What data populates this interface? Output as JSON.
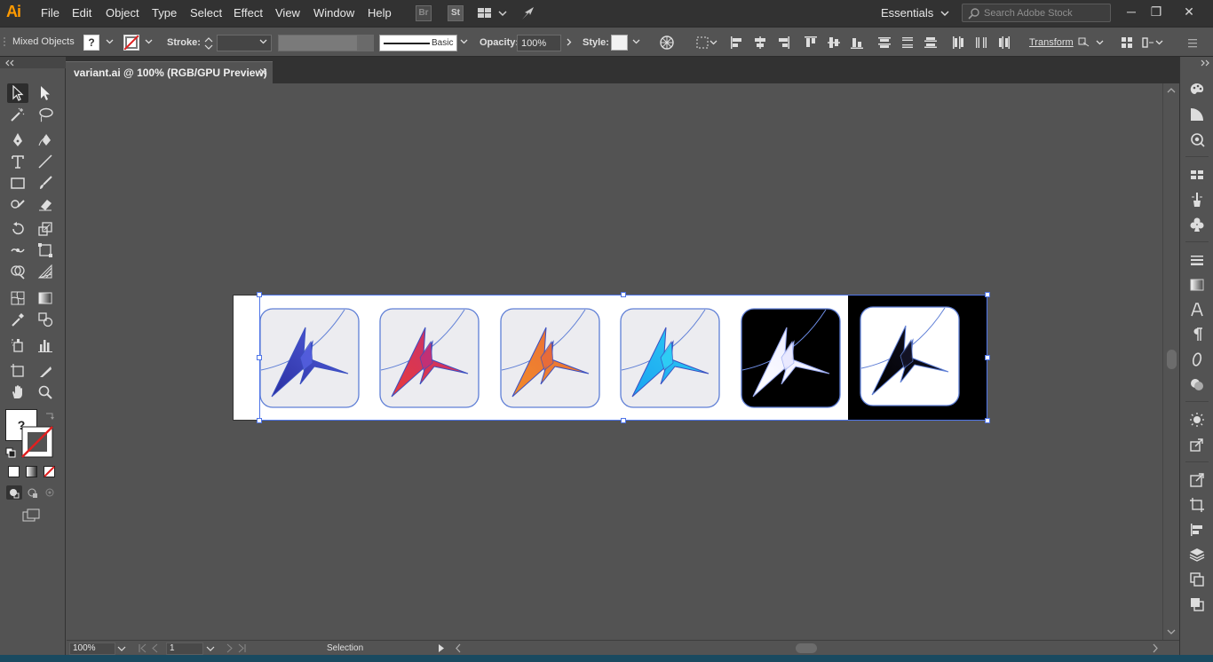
{
  "app": {
    "logo": "Ai"
  },
  "menu": [
    "File",
    "Edit",
    "Object",
    "Type",
    "Select",
    "Effect",
    "View",
    "Window",
    "Help"
  ],
  "menubar_badges": {
    "bridge": "Br",
    "stock": "St"
  },
  "workspace": "Essentials",
  "search": {
    "placeholder": "Search Adobe Stock"
  },
  "window_controls": {
    "minimize": "─",
    "restore": "❐",
    "close": "✕"
  },
  "control_bar": {
    "selection_type": "Mixed Objects",
    "fill_placeholder": "?",
    "stroke_label": "Stroke:",
    "brush_label": "Basic",
    "opacity_label": "Opacity:",
    "opacity_value": "100%",
    "style_label": "Style:",
    "transform_label": "Transform"
  },
  "document": {
    "tab_title": "variant.ai @ 100% (RGB/GPU Preview)",
    "close": "✕"
  },
  "toolbar": {
    "fill_placeholder": "?"
  },
  "status_bar": {
    "zoom": "100%",
    "artboard": "1",
    "tool": "Selection"
  },
  "variants": [
    {
      "name": "blue",
      "colors": [
        "#2a2fa0",
        "#5560e0"
      ],
      "bg": "#ececf0"
    },
    {
      "name": "red",
      "colors": [
        "#e83a3a",
        "#c0307a"
      ],
      "bg": "#ececf0"
    },
    {
      "name": "orange",
      "colors": [
        "#f28a2a",
        "#e86a3a"
      ],
      "bg": "#ececf0"
    },
    {
      "name": "cyan",
      "colors": [
        "#1aa3f0",
        "#2fd0f5"
      ],
      "bg": "#ececf0"
    },
    {
      "name": "white-on-black",
      "colors": [
        "#ffffff",
        "#e8e8ff"
      ],
      "bg": "#000000"
    },
    {
      "name": "black-on-white",
      "colors": [
        "#000000",
        "#141428"
      ],
      "bg": "#ffffff"
    }
  ],
  "colors": {
    "accent": "#ff9a00",
    "selection": "#4f75e8",
    "chrome_dark": "#323232",
    "chrome": "#535353"
  }
}
